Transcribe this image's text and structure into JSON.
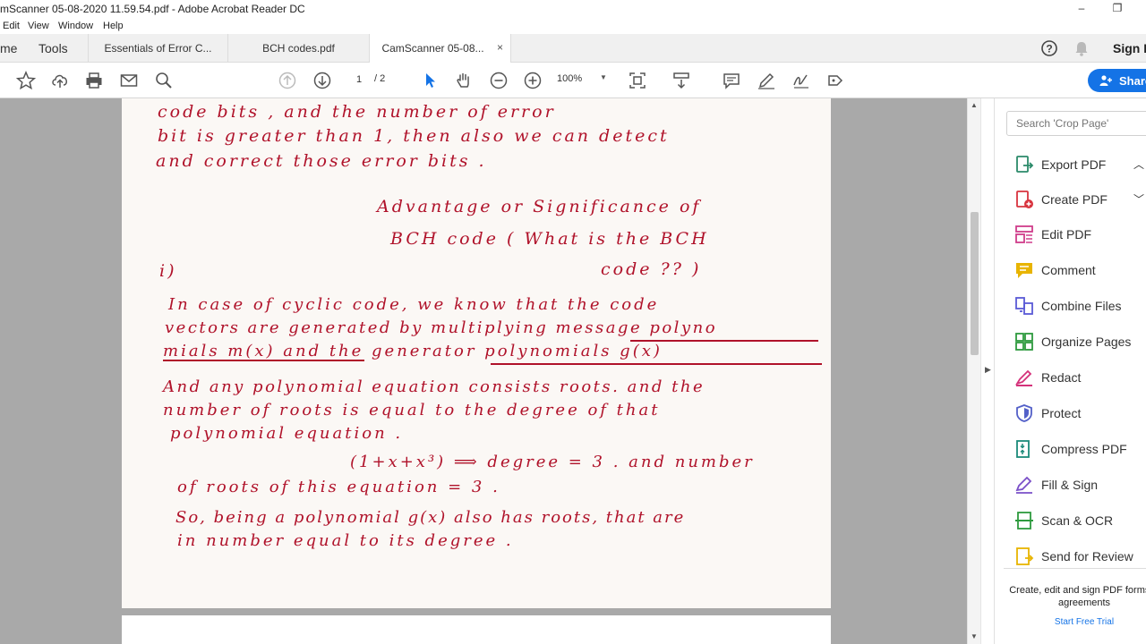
{
  "window": {
    "title": "mScanner 05-08-2020 11.59.54.pdf - Adobe Acrobat Reader DC",
    "minimize": "–",
    "restore": "❐"
  },
  "menu": [
    "Edit",
    "View",
    "Window",
    "Help"
  ],
  "tabs": {
    "home": "me",
    "tools": "Tools",
    "docs": [
      {
        "label": "Essentials of Error C..."
      },
      {
        "label": "BCH codes.pdf"
      },
      {
        "label": "CamScanner 05-08...",
        "close": "×"
      }
    ],
    "signin": "Sign I"
  },
  "toolbar": {
    "page_current": "1",
    "page_total": "/ 2",
    "zoom": "100%",
    "share": "Share",
    "icons": [
      "star-icon",
      "upload-icon",
      "print-icon",
      "email-icon",
      "search-icon",
      "page-up-icon",
      "page-down-icon",
      "select-arrow-icon",
      "hand-icon",
      "zoom-out-icon",
      "zoom-in-icon",
      "fit-page-icon",
      "scroll-mode-icon",
      "comment-icon",
      "pen-icon",
      "sign-icon",
      "more-tools-icon"
    ]
  },
  "document": {
    "lines": [
      "code bits , and the number of error",
      "bit is greater than 1, then also we can detect",
      "and correct those error bits .",
      "Advantage or Significance of",
      "BCH code ( What is the BCH",
      "code ?? )",
      "i)",
      "In case of cyclic code, we know that the code",
      "vectors are generated by multiplying message polyno",
      "mials m(x) and the generator polynomials g(x)",
      "And any polynomial equation consists roots. and the",
      "number of roots is equal to the degree of that",
      "polynomial equation .",
      "(1+x+x³) ⟹ degree = 3 . and number",
      "of roots of this equation = 3 .",
      "So, being a polynomial g(x) also has roots, that are",
      "in number equal to its degree ."
    ]
  },
  "right_panel": {
    "search_placeholder": "Search 'Crop Page'",
    "tools": [
      {
        "label": "Export PDF",
        "icon": "export-pdf-icon",
        "color": "#2b8a6a",
        "chev": "︿"
      },
      {
        "label": "Create PDF",
        "icon": "create-pdf-icon",
        "color": "#d8343f",
        "chev": "﹀"
      },
      {
        "label": "Edit PDF",
        "icon": "edit-pdf-icon",
        "color": "#cf3d8b"
      },
      {
        "label": "Comment",
        "icon": "comment-icon",
        "color": "#e8b400"
      },
      {
        "label": "Combine Files",
        "icon": "combine-files-icon",
        "color": "#5a5ad6"
      },
      {
        "label": "Organize Pages",
        "icon": "organize-pages-icon",
        "color": "#2e9a3e"
      },
      {
        "label": "Redact",
        "icon": "redact-icon",
        "color": "#d4317a"
      },
      {
        "label": "Protect",
        "icon": "protect-icon",
        "color": "#5360c8"
      },
      {
        "label": "Compress PDF",
        "icon": "compress-pdf-icon",
        "color": "#1c8a7a"
      },
      {
        "label": "Fill & Sign",
        "icon": "fill-sign-icon",
        "color": "#7a4fc8"
      },
      {
        "label": "Scan & OCR",
        "icon": "scan-ocr-icon",
        "color": "#2e9a3e"
      },
      {
        "label": "Send for Review",
        "icon": "send-review-icon",
        "color": "#e8b400"
      }
    ],
    "promo": "Create, edit and sign PDF forms & agreements",
    "trial": "Start Free Trial"
  }
}
